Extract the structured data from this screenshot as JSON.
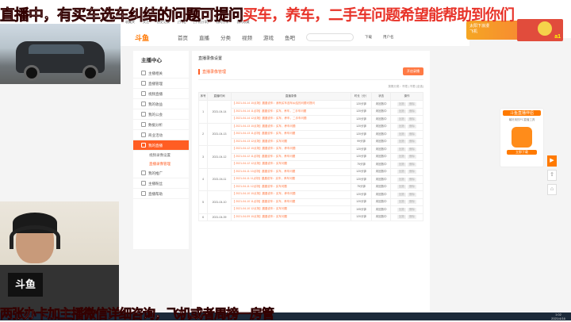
{
  "overlay": {
    "top_white": "直播中，有买车选车纠结的问题可提问",
    "top_red": "买车，养车，二手车问题希望能帮助到你们",
    "bottom": "两张办卡加主播微信详细咨询，飞机或者周榜一房管",
    "streamer_logo": "斗鱼"
  },
  "browser": {
    "items": [
      "收藏夹",
      "关注",
      "历史记录",
      "[手机]",
      "[手机分享]",
      "我的分享",
      "我的收藏"
    ]
  },
  "nav": {
    "logo": "斗鱼",
    "items": [
      "首页",
      "直播",
      "分类",
      "视频",
      "游戏",
      "鱼吧"
    ],
    "download": "下载",
    "user": "用户名"
  },
  "ad": {
    "line1": "太阳下浪漫",
    "line2": "飞机"
  },
  "pip_text": "a1",
  "sidebar": {
    "header": "主播中心",
    "items": [
      {
        "label": "主播相关"
      },
      {
        "label": "直播管理"
      },
      {
        "label": "视频直播"
      },
      {
        "label": "我的收益"
      },
      {
        "label": "我的公会"
      },
      {
        "label": "数据分析"
      },
      {
        "label": "商业活动"
      },
      {
        "label": "我的直播",
        "active": true
      }
    ],
    "subitems": [
      {
        "label": "视频录像设置"
      },
      {
        "label": "直播录像管理",
        "selected": true
      }
    ],
    "more": [
      {
        "label": "我的推广"
      },
      {
        "label": "主播粉丝"
      },
      {
        "label": "直播帮助"
      }
    ]
  },
  "main": {
    "page_title": "直播录像设置",
    "tab": "直播录像管理",
    "action_button": "开启录播",
    "filter_text": "按照分类：不限 | 不限 (全选)",
    "headers": [
      "序号",
      "直播时间",
      "直播录像",
      "时长（分）",
      "状态",
      "操作"
    ],
    "groups": [
      {
        "idx": "1",
        "date": "2021-04-14",
        "rows": [
          {
            "title": "【 2021-04-14 10点场】晨晨说车：我有买车选车纠结的问题可提问",
            "dur": "120分钟",
            "status": "未回放中"
          },
          {
            "title": "【 2021-04-14 11点场】晨晨说车：买车，养车，二手车问题",
            "dur": "120分钟",
            "status": "未回放中"
          },
          {
            "title": "【 2021-04-14 12点场】晨晨说车：买车，养车，二手车问题",
            "dur": "120分钟",
            "status": "未回放中"
          }
        ]
      },
      {
        "idx": "2",
        "date": "2021-04-13",
        "rows": [
          {
            "title": "【 2021-04-13 10点场】晨晨说车：买车，养车问题",
            "dur": "120分钟",
            "status": "未回放中"
          },
          {
            "title": "【 2021-04-13 11点场】晨晨说车：买车，养车问题",
            "dur": "120分钟",
            "status": "未回放中"
          },
          {
            "title": "【 2021-04-13 12点场】晨晨说车：买车问题",
            "dur": "99分钟",
            "status": "未回放中"
          }
        ]
      },
      {
        "idx": "3",
        "date": "2021-04-12",
        "rows": [
          {
            "title": "【 2021-04-12 10点场】晨晨说车：买车，养车问题",
            "dur": "120分钟",
            "status": "未回放中"
          },
          {
            "title": "【 2021-04-12 11点场】晨晨说车：买车，养车问题",
            "dur": "120分钟",
            "status": "未回放中"
          },
          {
            "title": "【 2021-04-12 12点场】晨晨说车：买车问题",
            "dur": "75分钟",
            "status": "未回放中"
          }
        ]
      },
      {
        "idx": "4",
        "date": "2021-04-11",
        "rows": [
          {
            "title": "【 2021-04-11 10点场】晨晨说车：买车，养车问题",
            "dur": "120分钟",
            "status": "未回放中"
          },
          {
            "title": "【 2021-04-11 11点场】晨晨说车：买车，养车问题",
            "dur": "120分钟",
            "status": "未回放中"
          },
          {
            "title": "【 2021-04-11 12点场】晨晨说车：买车问题",
            "dur": "75分钟",
            "status": "未回放中"
          }
        ]
      },
      {
        "idx": "5",
        "date": "2021-04-10",
        "rows": [
          {
            "title": "【 2021-04-10 10点场】晨晨说车：买车，养车问题",
            "dur": "120分钟",
            "status": "未回放中"
          },
          {
            "title": "【 2021-04-10 11点场】晨晨说车：买车，养车问题",
            "dur": "120分钟",
            "status": "未回放中"
          },
          {
            "title": "【 2021-04-10 12点场】晨晨说车：买车问题",
            "dur": "105分钟",
            "status": "未回放中"
          }
        ]
      },
      {
        "idx": "6",
        "date": "2021-04-09",
        "rows": [
          {
            "title": "【 2021-04-09 10点场】晨晨说车：买车问题",
            "dur": "120分钟",
            "status": "未回放中"
          }
        ]
      }
    ],
    "row_actions": [
      "回放",
      "删除"
    ]
  },
  "right_panel": {
    "title": "斗鱼直播伴侣",
    "desc": "最好用的PC直播工具",
    "download": "立即下载"
  },
  "tray": {
    "time": "1:02",
    "date": "2021/4/16"
  }
}
